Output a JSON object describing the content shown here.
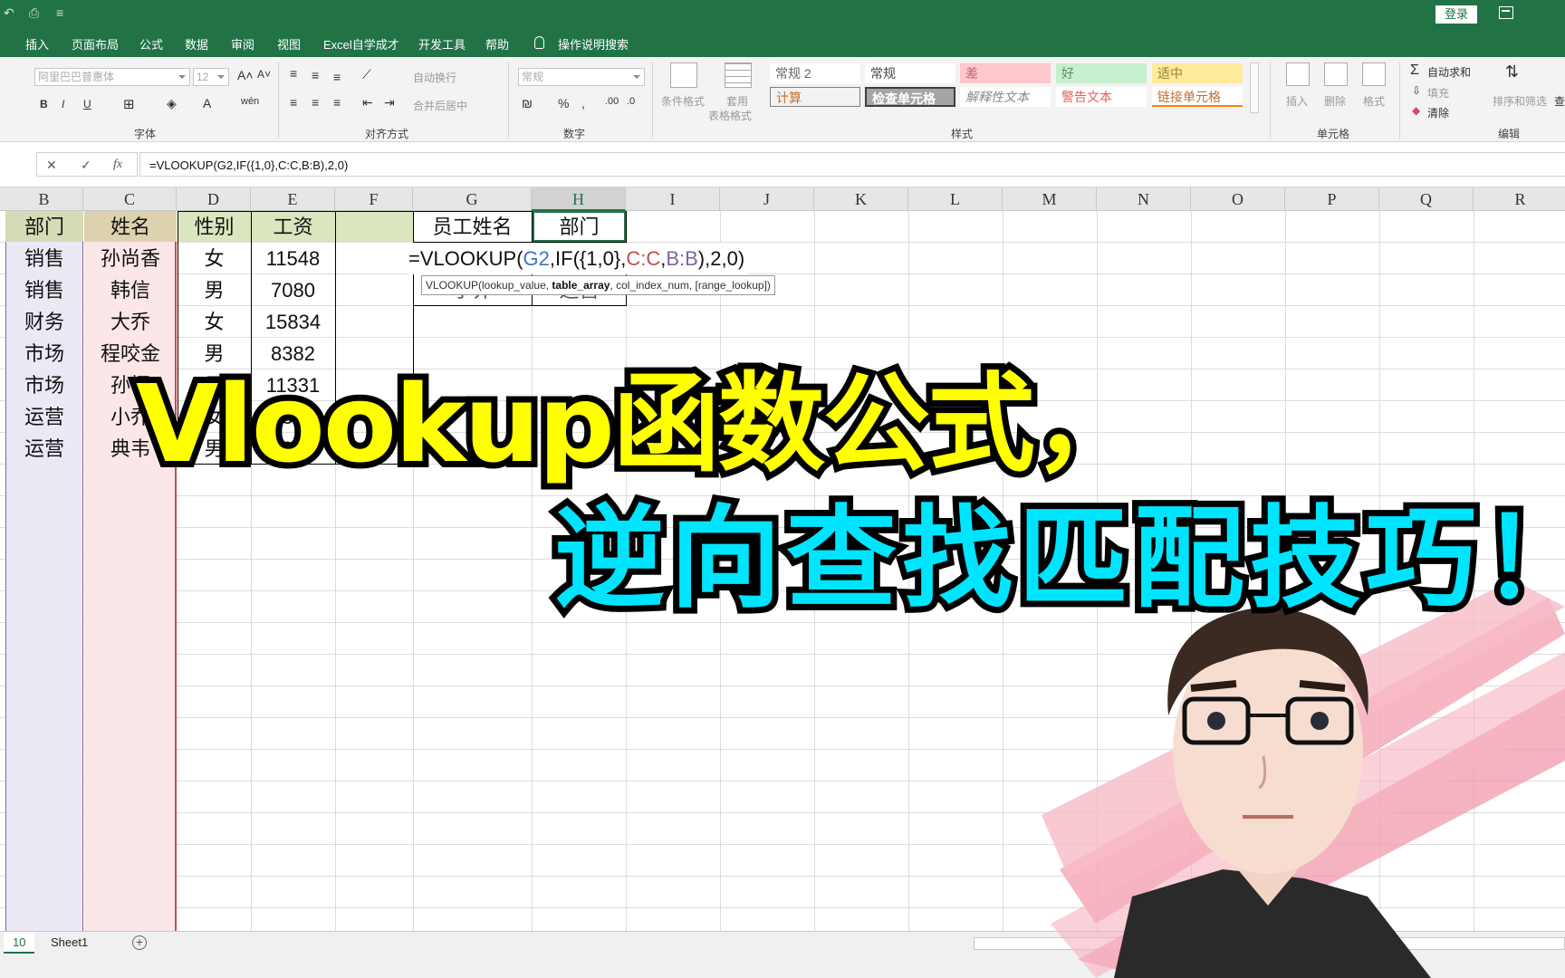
{
  "titlebar": {
    "quick_access": [
      "↶",
      "⎙",
      "≡"
    ],
    "login": "登录"
  },
  "ribbon_tabs": [
    "插入",
    "页面布局",
    "公式",
    "数据",
    "审阅",
    "视图",
    "Excel自学成才",
    "开发工具",
    "帮助",
    "操作说明搜索"
  ],
  "ribbon": {
    "groups": [
      "字体",
      "对齐方式",
      "数字",
      "样式",
      "单元格",
      "编辑"
    ],
    "font_name": "阿里巴巴普惠体",
    "font_size": "12",
    "wrap_text": "自动换行",
    "merge_center": "合并后居中",
    "number_format": "常规",
    "cond_format": "条件格式",
    "table_format_1": "套用",
    "table_format_2": "表格格式",
    "styles": [
      "常规 2",
      "常规",
      "差",
      "好",
      "适中",
      "计算",
      "检查单元格",
      "解释性文本",
      "警告文本",
      "链接单元格"
    ],
    "cells_buttons": [
      "插入",
      "删除",
      "格式"
    ],
    "autosum": "自动求和",
    "fill": "填充",
    "clear": "清除",
    "sort_filter": "排序和筛选",
    "find": "查"
  },
  "formula_bar": {
    "cancel": "✕",
    "enter": "✓",
    "fx": "fx",
    "value": "=VLOOKUP(G2,IF({1,0},C:C,B:B),2,0)"
  },
  "columns": [
    "B",
    "C",
    "D",
    "E",
    "F",
    "G",
    "H",
    "I",
    "J",
    "K",
    "L",
    "M",
    "N",
    "O",
    "P",
    "Q",
    "R"
  ],
  "table": {
    "headers": [
      "部门",
      "姓名",
      "性别",
      "工资"
    ],
    "rows": [
      [
        "销售",
        "孙尚香",
        "女",
        "11548"
      ],
      [
        "销售",
        "韩信",
        "男",
        "7080"
      ],
      [
        "财务",
        "大乔",
        "女",
        "15834"
      ],
      [
        "市场",
        "程咬金",
        "男",
        "8382"
      ],
      [
        "市场",
        "孙悟",
        "男",
        "11331"
      ],
      [
        "运营",
        "小乔",
        "女",
        "8344"
      ],
      [
        "运营",
        "典韦",
        "男",
        "9964"
      ]
    ]
  },
  "lookup": {
    "headers": [
      "员工姓名",
      "部门"
    ],
    "row_partial": [
      "小乔",
      "运营"
    ]
  },
  "formula_edit": {
    "parts": [
      "=VLOOKUP(",
      "G2",
      ",IF(",
      "{1,0}",
      ",",
      "C:C",
      ",",
      "B:B",
      "),2,0)"
    ],
    "colors": {
      "g2": "#4472c4",
      "cc": "#c0504d",
      "bb": "#8064a2"
    }
  },
  "tooltip": {
    "fn": "VLOOKUP(",
    "arg1": "lookup_value, ",
    "arg2": "table_array",
    "rest": ", col_index_num, [range_lookup])"
  },
  "sheets": {
    "current": "10",
    "name": "Sheet1"
  },
  "overlay": {
    "title_line1": "Vlookup函数公式，",
    "title_line2": "逆向查找匹配技巧！"
  },
  "colors": {
    "excel_green": "#217346",
    "title1": "#ffff00",
    "title2": "#00e5ff"
  }
}
